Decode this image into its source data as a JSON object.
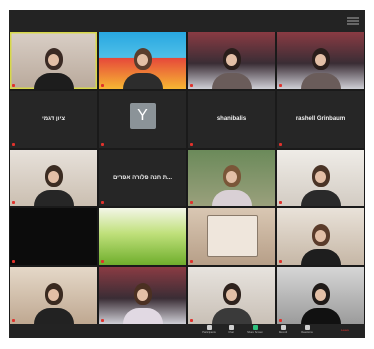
{
  "window": {
    "title": ""
  },
  "participants": [
    {
      "name": "",
      "kind": "video",
      "scene": "woman-wave"
    },
    {
      "name": "",
      "kind": "video",
      "scene": "balloon-room"
    },
    {
      "name": "",
      "kind": "video",
      "scene": "studio-red"
    },
    {
      "name": "",
      "kind": "video",
      "scene": "studio-red"
    },
    {
      "name": "ציון דגמי",
      "kind": "name"
    },
    {
      "name": "",
      "kind": "avatar",
      "initial": "Y"
    },
    {
      "name": "shanibalis",
      "kind": "name"
    },
    {
      "name": "rashell Grinbaum",
      "kind": "name"
    },
    {
      "name": "",
      "kind": "video",
      "scene": "girl-hat"
    },
    {
      "name": "ת חנה פלורה אפרים...",
      "kind": "name"
    },
    {
      "name": "",
      "kind": "video",
      "scene": "girl-smile"
    },
    {
      "name": "",
      "kind": "video",
      "scene": "girl-hat2"
    },
    {
      "name": "",
      "kind": "video",
      "scene": "dark"
    },
    {
      "name": "",
      "kind": "video",
      "scene": "grass"
    },
    {
      "name": "",
      "kind": "video",
      "scene": "paper-hand"
    },
    {
      "name": "",
      "kind": "video",
      "scene": "girl-redcap"
    },
    {
      "name": "",
      "kind": "video",
      "scene": "girl-wall"
    },
    {
      "name": "",
      "kind": "video",
      "scene": "studio-girl"
    },
    {
      "name": "",
      "kind": "video",
      "scene": "girl-room"
    },
    {
      "name": "",
      "kind": "video",
      "scene": "girl-room2"
    }
  ],
  "toolbar": {
    "buttons": [
      {
        "name": "participants-button",
        "label": "Participants",
        "icon": "people-icon"
      },
      {
        "name": "chat-button",
        "label": "Chat",
        "icon": "chat-icon"
      },
      {
        "name": "share-screen-button",
        "label": "Share Screen",
        "icon": "share-icon"
      },
      {
        "name": "record-button",
        "label": "Record",
        "icon": "record-icon"
      },
      {
        "name": "reactions-button",
        "label": "Reactions",
        "icon": "smile-icon"
      }
    ],
    "leave_label": "Leave",
    "participants_count": "33"
  },
  "colors": {
    "window_bg": "#1a1a1a",
    "active_border": "#d7d84a",
    "share_green": "#2ec27e",
    "leave_red": "#e0322c"
  }
}
